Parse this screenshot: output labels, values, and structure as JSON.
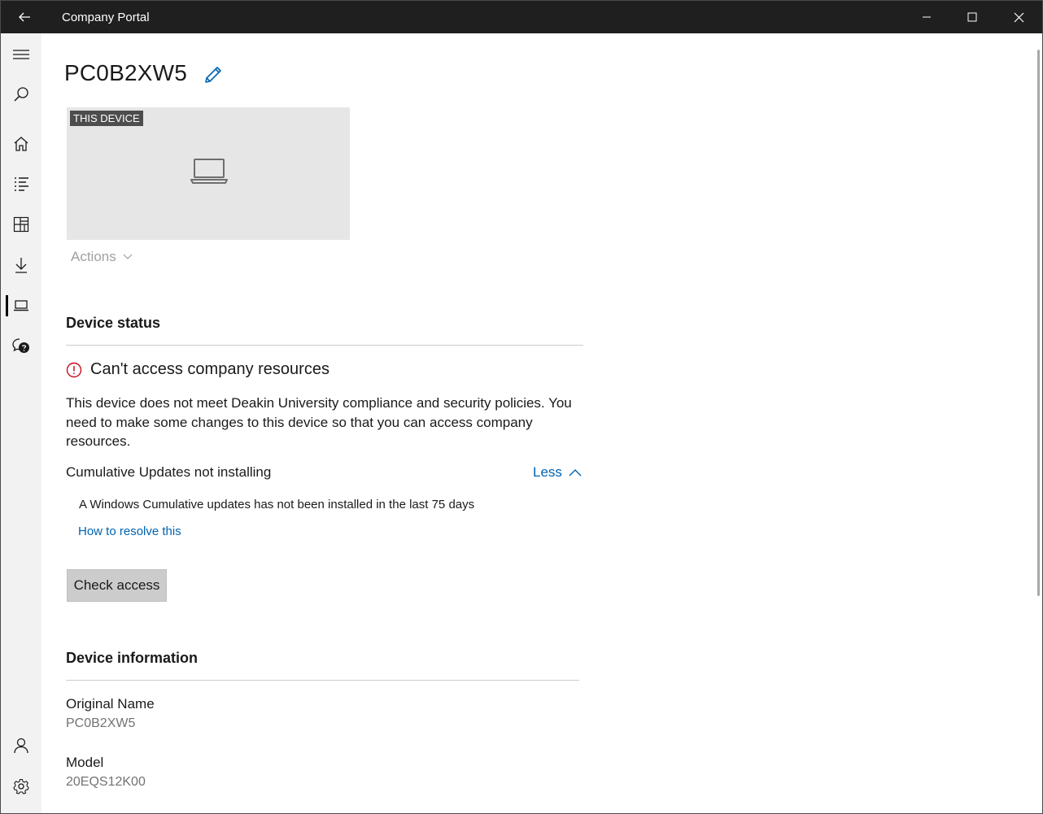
{
  "window": {
    "title": "Company Portal"
  },
  "sidebar": {
    "items": [
      {
        "icon": "hamburger-icon",
        "label": "Menu"
      },
      {
        "icon": "search-icon",
        "label": "Search"
      },
      {
        "icon": "home-icon",
        "label": "Home"
      },
      {
        "icon": "list-icon",
        "label": "Apps"
      },
      {
        "icon": "categories-icon",
        "label": "Categories"
      },
      {
        "icon": "download-icon",
        "label": "Downloads"
      },
      {
        "icon": "laptop-icon",
        "label": "Devices",
        "active": true
      },
      {
        "icon": "help-chat-icon",
        "label": "Help"
      },
      {
        "icon": "person-icon",
        "label": "Account"
      },
      {
        "icon": "gear-icon",
        "label": "Settings"
      }
    ]
  },
  "device": {
    "name": "PC0B2XW5",
    "tile_badge": "THIS DEVICE",
    "actions_label": "Actions"
  },
  "status": {
    "section_title": "Device status",
    "headline": "Can't access company resources",
    "description": "This device does not meet Deakin University compliance and security policies. You need to make some changes to this device so that you can access company resources.",
    "issue_title": "Cumulative Updates not installing",
    "toggle_label": "Less",
    "issue_detail": "A Windows Cumulative updates has not been installed in the last 75 days",
    "resolve_link": "How to resolve this",
    "check_button": "Check access"
  },
  "info": {
    "section_title": "Device information",
    "fields": [
      {
        "label": "Original Name",
        "value": "PC0B2XW5"
      },
      {
        "label": "Model",
        "value": "20EQS12K00"
      }
    ]
  },
  "colors": {
    "accent": "#0063b1",
    "warning": "#c50f1f",
    "titlebar": "#1f1f1f"
  }
}
